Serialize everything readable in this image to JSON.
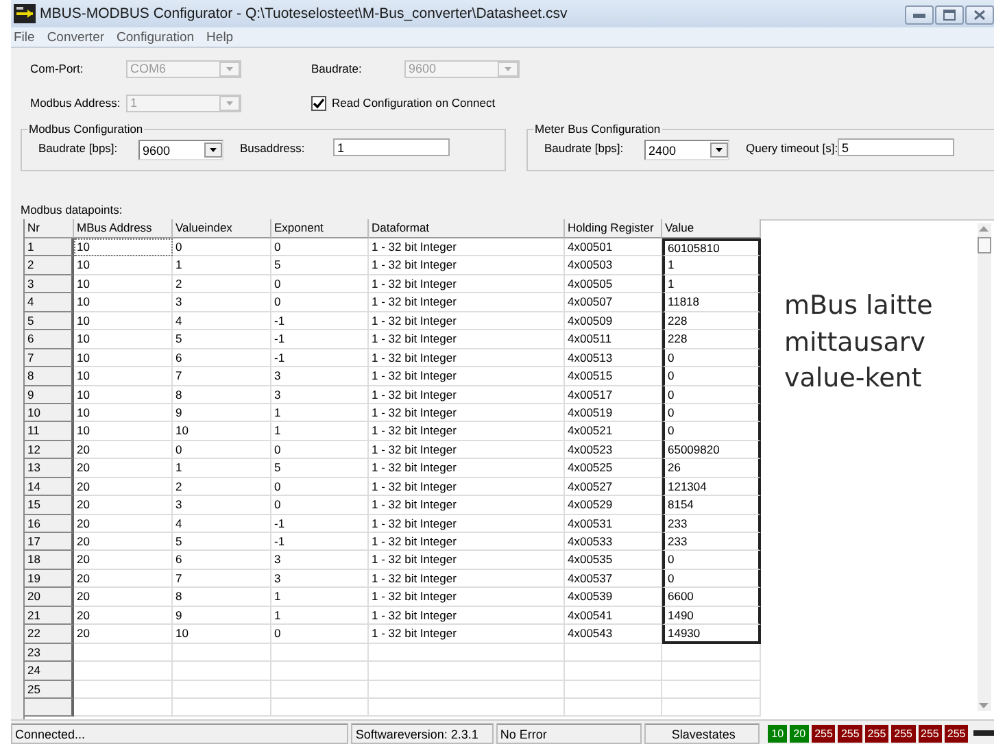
{
  "window": {
    "title": "MBUS-MODBUS Configurator - Q:\\Tuoteselosteet\\M-Bus_converter\\Datasheet.csv"
  },
  "menu": [
    "File",
    "Converter",
    "Configuration",
    "Help"
  ],
  "connection": {
    "com_port": {
      "label": "Com-Port:",
      "value": "COM6",
      "disabled": true
    },
    "baudrate": {
      "label": "Baudrate:",
      "value": "9600",
      "disabled": true
    },
    "modbus_address": {
      "label": "Modbus Address:",
      "value": "1",
      "disabled": true
    },
    "read_config": {
      "label": "Read Configuration on Connect",
      "checked": true
    }
  },
  "modbus_configuration": {
    "title": "Modbus Configuration",
    "baudrate": {
      "label": "Baudrate [bps]:",
      "value": "9600"
    },
    "busaddress": {
      "label": "Busaddress:",
      "value": "1"
    }
  },
  "meter_bus_configuration": {
    "title": "Meter Bus Configuration",
    "baudrate": {
      "label": "Baudrate [bps]:",
      "value": "2400"
    },
    "query_timeout": {
      "label": "Query timeout [s]:",
      "value": "5"
    }
  },
  "datapoints": {
    "label": "Modbus datapoints:",
    "columns": [
      {
        "title": "Nr",
        "highlighted": false
      },
      {
        "title": "MBus Address",
        "highlighted": false
      },
      {
        "title": "Valueindex",
        "highlighted": false
      },
      {
        "title": "Exponent",
        "highlighted": false
      },
      {
        "title": "Dataformat",
        "highlighted": false
      },
      {
        "title": "Holding Register",
        "highlighted": false
      },
      {
        "title": "Value",
        "highlighted": true
      }
    ],
    "rows": [
      [
        "1",
        "10",
        "0",
        "0",
        "1 - 32 bit Integer",
        "4x00501",
        "60105810"
      ],
      [
        "2",
        "10",
        "1",
        "5",
        "1 - 32 bit Integer",
        "4x00503",
        "1"
      ],
      [
        "3",
        "10",
        "2",
        "0",
        "1 - 32 bit Integer",
        "4x00505",
        "1"
      ],
      [
        "4",
        "10",
        "3",
        "0",
        "1 - 32 bit Integer",
        "4x00507",
        "11818"
      ],
      [
        "5",
        "10",
        "4",
        "-1",
        "1 - 32 bit Integer",
        "4x00509",
        "228"
      ],
      [
        "6",
        "10",
        "5",
        "-1",
        "1 - 32 bit Integer",
        "4x00511",
        "228"
      ],
      [
        "7",
        "10",
        "6",
        "-1",
        "1 - 32 bit Integer",
        "4x00513",
        "0"
      ],
      [
        "8",
        "10",
        "7",
        "3",
        "1 - 32 bit Integer",
        "4x00515",
        "0"
      ],
      [
        "9",
        "10",
        "8",
        "3",
        "1 - 32 bit Integer",
        "4x00517",
        "0"
      ],
      [
        "10",
        "10",
        "9",
        "1",
        "1 - 32 bit Integer",
        "4x00519",
        "0"
      ],
      [
        "11",
        "10",
        "10",
        "1",
        "1 - 32 bit Integer",
        "4x00521",
        "0"
      ],
      [
        "12",
        "20",
        "0",
        "0",
        "1 - 32 bit Integer",
        "4x00523",
        "65009820"
      ],
      [
        "13",
        "20",
        "1",
        "5",
        "1 - 32 bit Integer",
        "4x00525",
        "26"
      ],
      [
        "14",
        "20",
        "2",
        "0",
        "1 - 32 bit Integer",
        "4x00527",
        "121304"
      ],
      [
        "15",
        "20",
        "3",
        "0",
        "1 - 32 bit Integer",
        "4x00529",
        "8154"
      ],
      [
        "16",
        "20",
        "4",
        "-1",
        "1 - 32 bit Integer",
        "4x00531",
        "233"
      ],
      [
        "17",
        "20",
        "5",
        "-1",
        "1 - 32 bit Integer",
        "4x00533",
        "233"
      ],
      [
        "18",
        "20",
        "6",
        "3",
        "1 - 32 bit Integer",
        "4x00535",
        "0"
      ],
      [
        "19",
        "20",
        "7",
        "3",
        "1 - 32 bit Integer",
        "4x00537",
        "0"
      ],
      [
        "20",
        "20",
        "8",
        "1",
        "1 - 32 bit Integer",
        "4x00539",
        "6600"
      ],
      [
        "21",
        "20",
        "9",
        "1",
        "1 - 32 bit Integer",
        "4x00541",
        "1490"
      ],
      [
        "22",
        "20",
        "10",
        "0",
        "1 - 32 bit Integer",
        "4x00543",
        "14930"
      ]
    ],
    "empty_rows": [
      "23",
      "24",
      "25"
    ]
  },
  "note": {
    "lines": [
      "mBus laitte",
      "mittausarv",
      "value-kent"
    ]
  },
  "status_bar": {
    "status": "Connected...",
    "version": "Softwareversion: 2.3.1",
    "error": "No Error",
    "slavestates_label": "Slavestates",
    "slavestates": [
      {
        "text": "10",
        "color": "#008000"
      },
      {
        "text": "20",
        "color": "#008000"
      },
      {
        "text": "255",
        "color": "#8b0000"
      },
      {
        "text": "255",
        "color": "#8b0000"
      },
      {
        "text": "255",
        "color": "#8b0000"
      },
      {
        "text": "255",
        "color": "#8b0000"
      },
      {
        "text": "255",
        "color": "#8b0000"
      },
      {
        "text": "255",
        "color": "#8b0000"
      }
    ]
  }
}
